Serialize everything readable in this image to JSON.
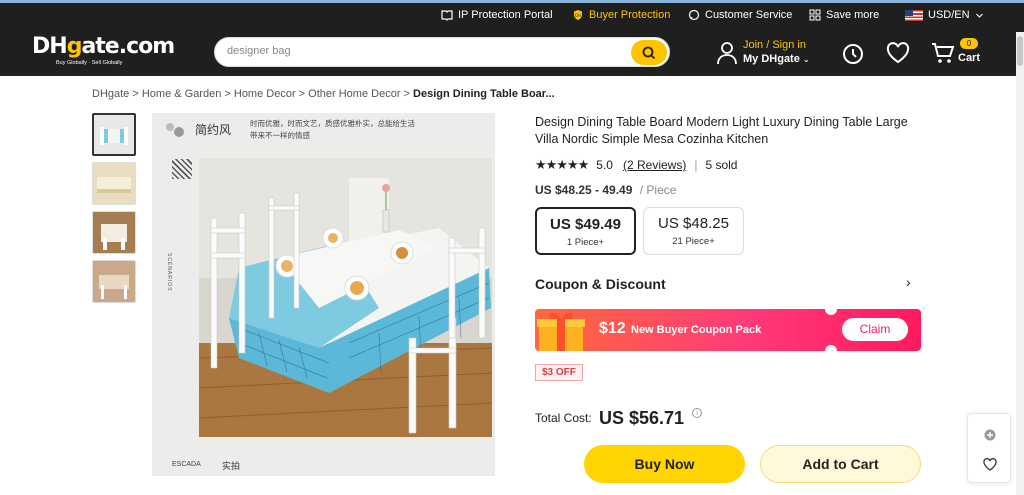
{
  "topbar": {
    "ip_protection": "IP Protection Portal",
    "buyer_protection": "Buyer Protection",
    "customer_service": "Customer Service",
    "save_more": "Save more",
    "currency": "USD/EN"
  },
  "header": {
    "logo_text": "DHgate.com",
    "logo_tagline": "Buy Globally · Sell Globally",
    "search_placeholder": "designer bag",
    "signin": "Join / Sign in",
    "my_dhgate": "My DHgate",
    "cart_count": "0",
    "cart_label": "Cart"
  },
  "breadcrumb": {
    "items": [
      "DHgate",
      "Home & Garden",
      "Home Decor",
      "Other Home Decor"
    ],
    "current": "Design Dining Table Boar..."
  },
  "main_image": {
    "title_cn": "简约风",
    "sub_cn_1": "时而优雅，时而文艺，质感优雅朴实，总能给生活",
    "sub_cn_2": "带来不一样的情感",
    "side_label": "SCENARIOS",
    "foot_en": "ESCADA",
    "foot_cn": "实拍"
  },
  "product": {
    "title": "Design Dining Table Board Modern Light Luxury Dining Table Large Villa Nordic Simple Mesa Cozinha Kitchen",
    "stars": "★★★★★",
    "rating": "5.0",
    "reviews": "(2 Reviews)",
    "sold": "5 sold",
    "price_range": "US $48.25 - 49.49",
    "price_unit": "/ Piece",
    "tiers": [
      {
        "price": "US $49.49",
        "qty": "1 Piece+"
      },
      {
        "price": "US $48.25",
        "qty": "21 Piece+"
      }
    ]
  },
  "coupon": {
    "title": "Coupon & Discount",
    "amount": "$12",
    "text": "New Buyer Coupon Pack",
    "claim": "Claim",
    "off_tag": "$3 OFF"
  },
  "purchase": {
    "total_label": "Total Cost:",
    "total_value": "US $56.71",
    "buy_now": "Buy Now",
    "add_to_cart": "Add to Cart"
  },
  "colors": {
    "brand_yellow": "#ffc400",
    "header_bg": "#1f1f1f",
    "coupon_pink": "#ff1a5e"
  }
}
